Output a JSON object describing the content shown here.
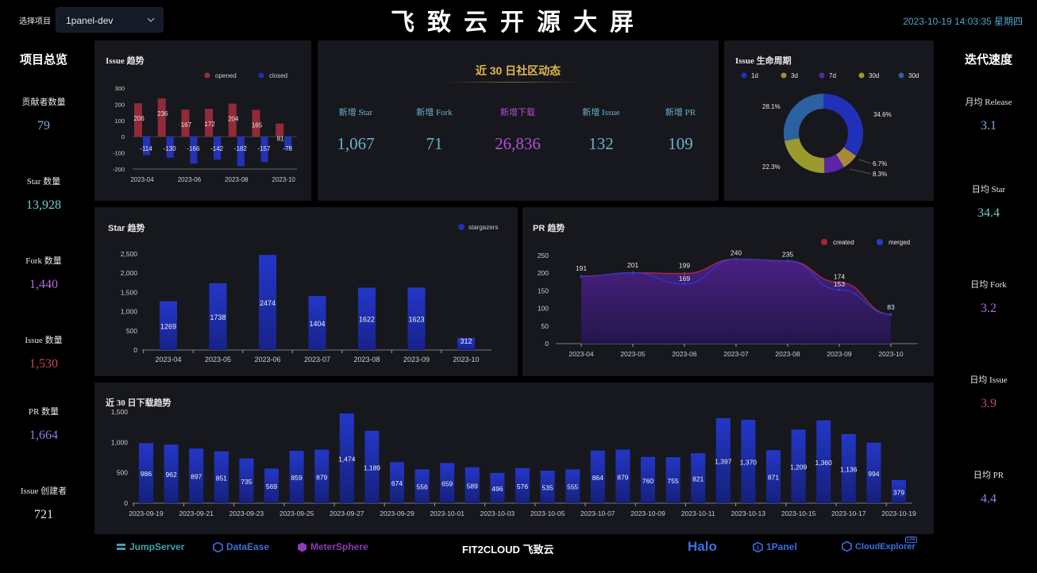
{
  "header": {
    "project_label": "选择项目",
    "project_value": "1panel-dev",
    "title": "飞致云开源大屏",
    "datetime": "2023-10-19 14:03:35 星期四"
  },
  "overview": {
    "title": "项目总览",
    "stats": [
      {
        "label": "贡献者数量",
        "value": "79",
        "color": "#7fb0e0"
      },
      {
        "label": "Star 数量",
        "value": "13,928",
        "color": "#6fd1c9"
      },
      {
        "label": "Fork 数量",
        "value": "1,440",
        "color": "#b26be0"
      },
      {
        "label": "Issue 数量",
        "value": "1,530",
        "color": "#c9475b"
      },
      {
        "label": "PR 数量",
        "value": "1,664",
        "color": "#8a82e6"
      },
      {
        "label": "Issue 创建者",
        "value": "721",
        "color": "#e6e6e6"
      }
    ]
  },
  "velocity": {
    "title": "迭代速度",
    "stats": [
      {
        "label": "月均 Release",
        "value": "3.1",
        "color": "#7fb0e0"
      },
      {
        "label": "日均 Star",
        "value": "34.4",
        "color": "#6fd1c9"
      },
      {
        "label": "日均 Fork",
        "value": "3.2",
        "color": "#b26be0"
      },
      {
        "label": "日均 Issue",
        "value": "3.9",
        "color": "#c9475b"
      },
      {
        "label": "日均 PR",
        "value": "4.4",
        "color": "#8a82e6"
      }
    ]
  },
  "community": {
    "title": "近 30 日社区动态",
    "items": [
      {
        "label": "新增 Star",
        "value": "1,067",
        "color": "#6ab0cf"
      },
      {
        "label": "新增 Fork",
        "value": "71",
        "color": "#6ab0cf"
      },
      {
        "label": "新增下载",
        "value": "26,836",
        "color": "#b44fd6"
      },
      {
        "label": "新增 Issue",
        "value": "132",
        "color": "#6ab0cf"
      },
      {
        "label": "新增 PR",
        "value": "109",
        "color": "#6ab0cf"
      }
    ]
  },
  "colors": {
    "blue": "#1f2fb8",
    "red": "#9e2b3a",
    "panel": "#17181d",
    "axis_text": "#c9ccd4"
  },
  "footer": {
    "logos": [
      {
        "text": "JumpServer",
        "icon": "jumpserver-icon",
        "color": "#3fa1a8"
      },
      {
        "text": "DataEase",
        "icon": "dataease-icon",
        "color": "#3f6fd8"
      },
      {
        "text": "MeterSphere",
        "icon": "metersphere-icon",
        "color": "#8c3bb8"
      },
      {
        "text": "FIT2CLOUD 飞致云",
        "icon": "",
        "color": "#ffffff"
      },
      {
        "text": "Halo",
        "icon": "",
        "color": "#3a6fe0"
      },
      {
        "text": "1Panel",
        "icon": "1panel-icon",
        "color": "#3a6fe0"
      },
      {
        "text": "CloudExplorer",
        "icon": "cloudexplorer-icon",
        "color": "#3a6fe0"
      }
    ],
    "lite_badge": "Lite"
  },
  "chart_data": [
    {
      "id": "issue_trend",
      "type": "bar",
      "title": "Issue 趋势",
      "categories": [
        "2023-04",
        "2023-05",
        "2023-06",
        "2023-07",
        "2023-08",
        "2023-09",
        "2023-10"
      ],
      "xticks": [
        "2023-04",
        "2023-06",
        "2023-08",
        "2023-10"
      ],
      "series": [
        {
          "name": "opened",
          "values": [
            206,
            236,
            167,
            172,
            204,
            165,
            81
          ]
        },
        {
          "name": "closed",
          "values": [
            -114,
            -130,
            -166,
            -142,
            -182,
            -157,
            -78
          ]
        }
      ],
      "ylim": [
        -200,
        300
      ],
      "yticks": [
        300,
        200,
        100,
        0,
        -100,
        -200
      ],
      "legend": "top-right"
    },
    {
      "id": "issue_lifecycle",
      "type": "pie",
      "title": "Issue 生命周期",
      "legend_labels": [
        "1d",
        "3d",
        "7d",
        "30d",
        "30d"
      ],
      "slices": [
        {
          "name": "1d",
          "value": 34.6,
          "label": "34.6%",
          "color": "#2130b8"
        },
        {
          "name": "3d",
          "value": 6.7,
          "label": "6.7%",
          "color": "#a88a3a"
        },
        {
          "name": "7d",
          "value": 8.3,
          "label": "8.3%",
          "color": "#5d24a8"
        },
        {
          "name": "30d",
          "value": 22.3,
          "label": "22.3%",
          "color": "#9a9a2e"
        },
        {
          "name": "30d",
          "value": 28.1,
          "label": "28.1%",
          "color": "#2b61a0"
        }
      ],
      "legend": "top"
    },
    {
      "id": "star_trend",
      "type": "bar",
      "title": "Star 趋势",
      "categories": [
        "2023-04",
        "2023-05",
        "2023-06",
        "2023-07",
        "2023-08",
        "2023-09",
        "2023-10"
      ],
      "series": [
        {
          "name": "stargazers",
          "values": [
            1269,
            1738,
            2474,
            1404,
            1622,
            1623,
            312
          ]
        }
      ],
      "ylim": [
        0,
        2500
      ],
      "yticks": [
        "2,500",
        "2,000",
        "1,500",
        "1,000",
        "500",
        "0"
      ],
      "legend": "top-right"
    },
    {
      "id": "pr_trend",
      "type": "area",
      "title": "PR 趋势",
      "categories": [
        "2023-04",
        "2023-05",
        "2023-06",
        "2023-07",
        "2023-08",
        "2023-09",
        "2023-10"
      ],
      "series": [
        {
          "name": "created",
          "values": [
            191,
            201,
            199,
            240,
            235,
            174,
            83
          ]
        },
        {
          "name": "merged",
          "values": [
            191,
            201,
            169,
            240,
            235,
            153,
            83
          ]
        }
      ],
      "point_labels": [
        "191",
        "201",
        "199",
        "169",
        "240",
        "235",
        "174",
        "153",
        "83"
      ],
      "ylim": [
        0,
        250
      ],
      "yticks": [
        "250",
        "200",
        "150",
        "100",
        "50",
        "0"
      ],
      "legend": "top-right"
    },
    {
      "id": "downloads",
      "type": "bar",
      "title": "近 30 日下载趋势",
      "categories": [
        "2023-09-19",
        "2023-09-20",
        "2023-09-21",
        "2023-09-22",
        "2023-09-23",
        "2023-09-24",
        "2023-09-25",
        "2023-09-26",
        "2023-09-27",
        "2023-09-28",
        "2023-09-29",
        "2023-09-30",
        "2023-10-01",
        "2023-10-02",
        "2023-10-03",
        "2023-10-04",
        "2023-10-05",
        "2023-10-06",
        "2023-10-07",
        "2023-10-08",
        "2023-10-09",
        "2023-10-10",
        "2023-10-11",
        "2023-10-12",
        "2023-10-13",
        "2023-10-14",
        "2023-10-15",
        "2023-10-16",
        "2023-10-17",
        "2023-10-18",
        "2023-10-19"
      ],
      "values": [
        986,
        962,
        897,
        851,
        735,
        569,
        859,
        879,
        1474,
        1189,
        674,
        556,
        659,
        589,
        496,
        576,
        535,
        555,
        864,
        879,
        760,
        755,
        821,
        1397,
        1370,
        871,
        1209,
        1360,
        1136,
        994,
        379
      ],
      "labels": [
        "986",
        "962",
        "897",
        "851",
        "735",
        "569",
        "859",
        "879",
        "1,474",
        "1,189",
        "674",
        "556",
        "659",
        "589",
        "496",
        "576",
        "535",
        "555",
        "864",
        "879",
        "760",
        "755",
        "821",
        "1,397",
        "1,370",
        "871",
        "1,209",
        "1,360",
        "1,136",
        "994",
        "379"
      ],
      "xticks": [
        "2023-09-19",
        "2023-09-21",
        "2023-09-23",
        "2023-09-25",
        "2023-09-27",
        "2023-09-29",
        "2023-10-01",
        "2023-10-03",
        "2023-10-05",
        "2023-10-07",
        "2023-10-09",
        "2023-10-11",
        "2023-10-13",
        "2023-10-15",
        "2023-10-17",
        "2023-10-19"
      ],
      "ylim": [
        0,
        1500
      ],
      "yticks": [
        "1,500",
        "1,000",
        "500",
        "0"
      ]
    }
  ]
}
